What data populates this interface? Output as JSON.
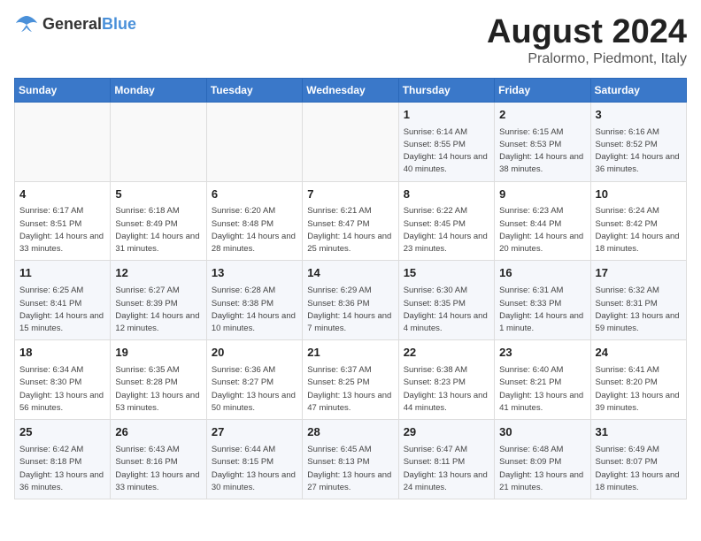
{
  "header": {
    "logo_general": "General",
    "logo_blue": "Blue",
    "month_title": "August 2024",
    "location": "Pralormo, Piedmont, Italy"
  },
  "days_of_week": [
    "Sunday",
    "Monday",
    "Tuesday",
    "Wednesday",
    "Thursday",
    "Friday",
    "Saturday"
  ],
  "weeks": [
    [
      {
        "date": "",
        "info": ""
      },
      {
        "date": "",
        "info": ""
      },
      {
        "date": "",
        "info": ""
      },
      {
        "date": "",
        "info": ""
      },
      {
        "date": "1",
        "info": "Sunrise: 6:14 AM\nSunset: 8:55 PM\nDaylight: 14 hours and 40 minutes."
      },
      {
        "date": "2",
        "info": "Sunrise: 6:15 AM\nSunset: 8:53 PM\nDaylight: 14 hours and 38 minutes."
      },
      {
        "date": "3",
        "info": "Sunrise: 6:16 AM\nSunset: 8:52 PM\nDaylight: 14 hours and 36 minutes."
      }
    ],
    [
      {
        "date": "4",
        "info": "Sunrise: 6:17 AM\nSunset: 8:51 PM\nDaylight: 14 hours and 33 minutes."
      },
      {
        "date": "5",
        "info": "Sunrise: 6:18 AM\nSunset: 8:49 PM\nDaylight: 14 hours and 31 minutes."
      },
      {
        "date": "6",
        "info": "Sunrise: 6:20 AM\nSunset: 8:48 PM\nDaylight: 14 hours and 28 minutes."
      },
      {
        "date": "7",
        "info": "Sunrise: 6:21 AM\nSunset: 8:47 PM\nDaylight: 14 hours and 25 minutes."
      },
      {
        "date": "8",
        "info": "Sunrise: 6:22 AM\nSunset: 8:45 PM\nDaylight: 14 hours and 23 minutes."
      },
      {
        "date": "9",
        "info": "Sunrise: 6:23 AM\nSunset: 8:44 PM\nDaylight: 14 hours and 20 minutes."
      },
      {
        "date": "10",
        "info": "Sunrise: 6:24 AM\nSunset: 8:42 PM\nDaylight: 14 hours and 18 minutes."
      }
    ],
    [
      {
        "date": "11",
        "info": "Sunrise: 6:25 AM\nSunset: 8:41 PM\nDaylight: 14 hours and 15 minutes."
      },
      {
        "date": "12",
        "info": "Sunrise: 6:27 AM\nSunset: 8:39 PM\nDaylight: 14 hours and 12 minutes."
      },
      {
        "date": "13",
        "info": "Sunrise: 6:28 AM\nSunset: 8:38 PM\nDaylight: 14 hours and 10 minutes."
      },
      {
        "date": "14",
        "info": "Sunrise: 6:29 AM\nSunset: 8:36 PM\nDaylight: 14 hours and 7 minutes."
      },
      {
        "date": "15",
        "info": "Sunrise: 6:30 AM\nSunset: 8:35 PM\nDaylight: 14 hours and 4 minutes."
      },
      {
        "date": "16",
        "info": "Sunrise: 6:31 AM\nSunset: 8:33 PM\nDaylight: 14 hours and 1 minute."
      },
      {
        "date": "17",
        "info": "Sunrise: 6:32 AM\nSunset: 8:31 PM\nDaylight: 13 hours and 59 minutes."
      }
    ],
    [
      {
        "date": "18",
        "info": "Sunrise: 6:34 AM\nSunset: 8:30 PM\nDaylight: 13 hours and 56 minutes."
      },
      {
        "date": "19",
        "info": "Sunrise: 6:35 AM\nSunset: 8:28 PM\nDaylight: 13 hours and 53 minutes."
      },
      {
        "date": "20",
        "info": "Sunrise: 6:36 AM\nSunset: 8:27 PM\nDaylight: 13 hours and 50 minutes."
      },
      {
        "date": "21",
        "info": "Sunrise: 6:37 AM\nSunset: 8:25 PM\nDaylight: 13 hours and 47 minutes."
      },
      {
        "date": "22",
        "info": "Sunrise: 6:38 AM\nSunset: 8:23 PM\nDaylight: 13 hours and 44 minutes."
      },
      {
        "date": "23",
        "info": "Sunrise: 6:40 AM\nSunset: 8:21 PM\nDaylight: 13 hours and 41 minutes."
      },
      {
        "date": "24",
        "info": "Sunrise: 6:41 AM\nSunset: 8:20 PM\nDaylight: 13 hours and 39 minutes."
      }
    ],
    [
      {
        "date": "25",
        "info": "Sunrise: 6:42 AM\nSunset: 8:18 PM\nDaylight: 13 hours and 36 minutes."
      },
      {
        "date": "26",
        "info": "Sunrise: 6:43 AM\nSunset: 8:16 PM\nDaylight: 13 hours and 33 minutes."
      },
      {
        "date": "27",
        "info": "Sunrise: 6:44 AM\nSunset: 8:15 PM\nDaylight: 13 hours and 30 minutes."
      },
      {
        "date": "28",
        "info": "Sunrise: 6:45 AM\nSunset: 8:13 PM\nDaylight: 13 hours and 27 minutes."
      },
      {
        "date": "29",
        "info": "Sunrise: 6:47 AM\nSunset: 8:11 PM\nDaylight: 13 hours and 24 minutes."
      },
      {
        "date": "30",
        "info": "Sunrise: 6:48 AM\nSunset: 8:09 PM\nDaylight: 13 hours and 21 minutes."
      },
      {
        "date": "31",
        "info": "Sunrise: 6:49 AM\nSunset: 8:07 PM\nDaylight: 13 hours and 18 minutes."
      }
    ]
  ]
}
